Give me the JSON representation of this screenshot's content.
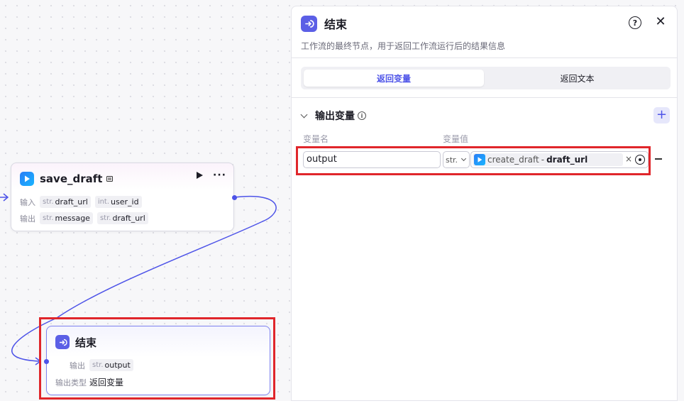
{
  "save_node": {
    "title": "save_draft",
    "input_label": "输入",
    "output_label": "输出",
    "inputs": [
      {
        "type": "str.",
        "name": "draft_url"
      },
      {
        "type": "int.",
        "name": "user_id"
      }
    ],
    "outputs": [
      {
        "type": "str.",
        "name": "message"
      },
      {
        "type": "str.",
        "name": "draft_url"
      }
    ]
  },
  "end_node": {
    "title": "结束",
    "output_label": "输出",
    "output": {
      "type": "str.",
      "name": "output"
    },
    "output_type_label": "输出类型",
    "output_type_value": "返回变量"
  },
  "panel": {
    "title": "结束",
    "description": "工作流的最终节点，用于返回工作流运行后的结果信息",
    "tabs": [
      "返回变量",
      "返回文本"
    ],
    "active_tab": "返回变量",
    "section_title": "输出变量",
    "col_name": "变量名",
    "col_value": "变量值",
    "variable": {
      "name": "output",
      "type": "str.",
      "ref_node": "create_draft",
      "ref_sep": "-",
      "ref_field": "draft_url"
    }
  },
  "colors": {
    "accent": "#4d53e8",
    "end_icon": "#5b5fe6",
    "highlight": "#e0262b"
  }
}
